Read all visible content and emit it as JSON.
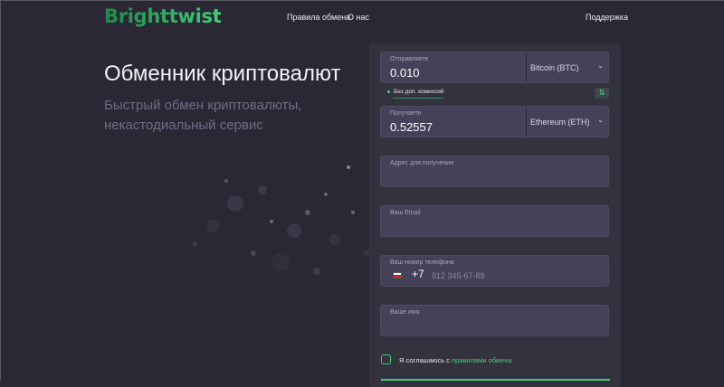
{
  "header": {
    "logo": "Brighttwist",
    "nav": {
      "rules": "Правила обмена",
      "about": "О нас",
      "support": "Поддержка"
    }
  },
  "hero": {
    "title": "Обменник криптовалют",
    "subtitle": "Быстрый обмен криптовалюты, некастодиальный сервис"
  },
  "exchange": {
    "send": {
      "label": "Отправляете",
      "amount": "0.010",
      "currency": "Bitcoin (BTC)"
    },
    "fee_note": "Без доп. комиссий",
    "swap_icon": "swap-arrows-icon",
    "receive": {
      "label": "Получаете",
      "amount": "0.52557",
      "currency": "Ethereum (ETH)"
    },
    "address_label": "Адрес для получения",
    "email_label": "Ваш Email",
    "phone": {
      "label": "Ваш номер телефона",
      "code": "+7",
      "placeholder": "912 345-67-89"
    },
    "name_label": "Ваше имя",
    "agree": {
      "prefix": "Я соглашаюсь с ",
      "link": "правилами обмена"
    }
  },
  "colors": {
    "accent": "#3fcf78",
    "background": "#2a2834",
    "panel": "#35323f",
    "field": "#454158"
  }
}
